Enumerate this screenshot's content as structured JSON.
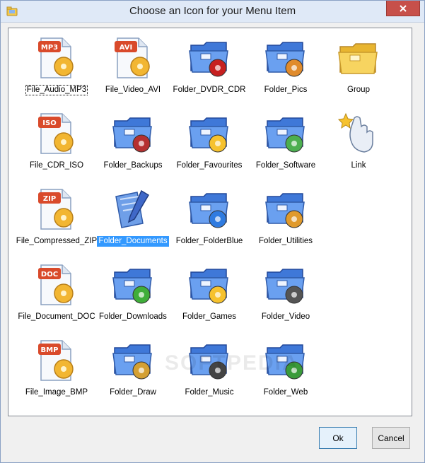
{
  "window": {
    "title": "Choose an Icon for your Menu Item"
  },
  "icons": [
    {
      "label": "File_Audio_MP3",
      "badge": "MP3",
      "kind": "file",
      "accent": "#d94a2b",
      "icon": "audio-file-icon"
    },
    {
      "label": "File_Video_AVI",
      "badge": "AVI",
      "kind": "file",
      "accent": "#d94a2b",
      "icon": "video-file-icon"
    },
    {
      "label": "Folder_DVDR_CDR",
      "kind": "folder",
      "accent": "#c62020",
      "icon": "dvd-folder-icon"
    },
    {
      "label": "Folder_Pics",
      "kind": "folder",
      "accent": "#e08b2c",
      "icon": "pictures-folder-icon"
    },
    {
      "label": "Group",
      "kind": "yfolder",
      "accent": "#f2c94c",
      "icon": "group-folder-icon"
    },
    {
      "label": "File_CDR_ISO",
      "badge": "ISO",
      "kind": "file",
      "accent": "#d94a2b",
      "icon": "iso-file-icon"
    },
    {
      "label": "Folder_Backups",
      "kind": "folder",
      "accent": "#b53030",
      "icon": "backups-folder-icon"
    },
    {
      "label": "Folder_Favourites",
      "kind": "folder",
      "accent": "#f6c22e",
      "icon": "favourites-folder-icon"
    },
    {
      "label": "Folder_Software",
      "kind": "folder",
      "accent": "#4caf50",
      "icon": "software-folder-icon"
    },
    {
      "label": "Link",
      "kind": "link",
      "accent": "#f6c22e",
      "icon": "link-hand-icon"
    },
    {
      "label": "File_Compressed_ZIP",
      "badge": "ZIP",
      "kind": "file",
      "accent": "#d94a2b",
      "icon": "zip-file-icon"
    },
    {
      "label": "Folder_Documents",
      "kind": "docfolder",
      "accent": "#3a6fd8",
      "icon": "documents-folder-icon"
    },
    {
      "label": "Folder_FolderBlue",
      "kind": "folder",
      "accent": "#2f7be0",
      "icon": "blue-folder-icon"
    },
    {
      "label": "Folder_Utilities",
      "kind": "folder",
      "accent": "#e09a2c",
      "icon": "utilities-folder-icon"
    },
    {
      "label": "File_Document_DOC",
      "badge": "DOC",
      "kind": "file",
      "accent": "#d94a2b",
      "icon": "doc-file-icon"
    },
    {
      "label": "Folder_Downloads",
      "kind": "folder",
      "accent": "#3fae3a",
      "icon": "downloads-folder-icon"
    },
    {
      "label": "Folder_Games",
      "kind": "folder",
      "accent": "#f6c22e",
      "icon": "games-folder-icon"
    },
    {
      "label": "Folder_Video",
      "kind": "folder",
      "accent": "#555555",
      "icon": "video-folder-icon"
    },
    {
      "label": "File_Image_BMP",
      "badge": "BMP",
      "kind": "file",
      "accent": "#d94a2b",
      "icon": "bmp-file-icon"
    },
    {
      "label": "Folder_Draw",
      "kind": "folder",
      "accent": "#d4a033",
      "icon": "draw-folder-icon"
    },
    {
      "label": "Folder_Music",
      "kind": "folder",
      "accent": "#444444",
      "icon": "music-folder-icon"
    },
    {
      "label": "Folder_Web",
      "kind": "folder",
      "accent": "#3a9b3a",
      "icon": "web-folder-icon"
    }
  ],
  "selected_label": "Folder_Documents",
  "focused_label": "File_Audio_MP3",
  "watermark": "SOFTPEDIA",
  "buttons": {
    "ok": "Ok",
    "cancel": "Cancel"
  }
}
